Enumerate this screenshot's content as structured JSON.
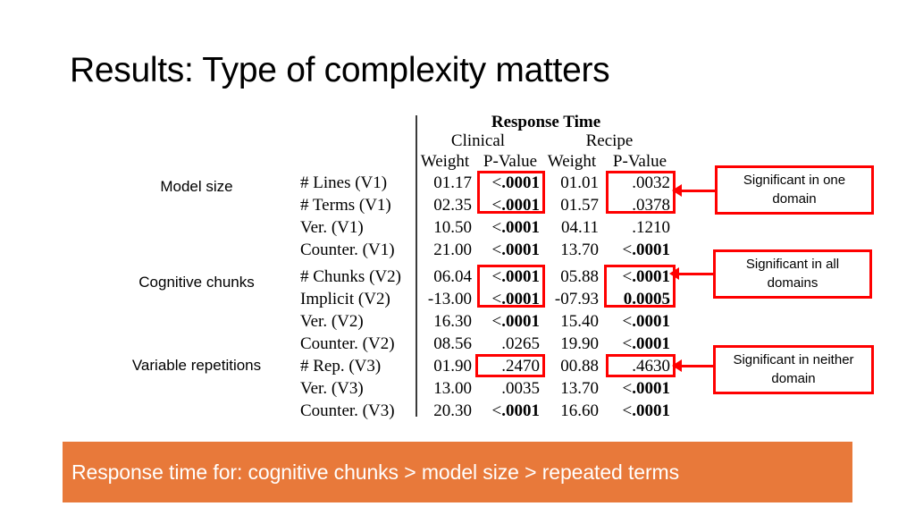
{
  "slide": {
    "title": "Results: Type of complexity matters"
  },
  "categories": [
    {
      "label": "Model size"
    },
    {
      "label": "Cognitive chunks"
    },
    {
      "label": "Variable repetitions"
    }
  ],
  "table": {
    "super_header": "Response Time",
    "group_headers": {
      "clinical": "Clinical",
      "recipe": "Recipe"
    },
    "column_headers": {
      "clinical_weight": "Weight",
      "clinical_pvalue": "P-Value",
      "recipe_weight": "Weight",
      "recipe_pvalue": "P-Value"
    },
    "groups": [
      {
        "name": "Model size",
        "rows": [
          {
            "label": "# Lines (V1)",
            "clinical_weight": "01.17",
            "clinical_p_prefix": "<",
            "clinical_p_value": ".0001",
            "clinical_p_bold": true,
            "recipe_weight": "01.01",
            "recipe_p_prefix": "",
            "recipe_p_value": ".0032",
            "recipe_p_bold": false
          },
          {
            "label": "# Terms (V1)",
            "clinical_weight": "02.35",
            "clinical_p_prefix": "<",
            "clinical_p_value": ".0001",
            "clinical_p_bold": true,
            "recipe_weight": "01.57",
            "recipe_p_prefix": "",
            "recipe_p_value": ".0378",
            "recipe_p_bold": false
          },
          {
            "label": "Ver. (V1)",
            "clinical_weight": "10.50",
            "clinical_p_prefix": "<",
            "clinical_p_value": ".0001",
            "clinical_p_bold": true,
            "recipe_weight": "04.11",
            "recipe_p_prefix": "",
            "recipe_p_value": ".1210",
            "recipe_p_bold": false
          },
          {
            "label": "Counter. (V1)",
            "clinical_weight": "21.00",
            "clinical_p_prefix": "<",
            "clinical_p_value": ".0001",
            "clinical_p_bold": true,
            "recipe_weight": "13.70",
            "recipe_p_prefix": "<",
            "recipe_p_value": ".0001",
            "recipe_p_bold": true
          }
        ]
      },
      {
        "name": "Cognitive chunks",
        "rows": [
          {
            "label": "# Chunks (V2)",
            "clinical_weight": "06.04",
            "clinical_p_prefix": "<",
            "clinical_p_value": ".0001",
            "clinical_p_bold": true,
            "recipe_weight": "05.88",
            "recipe_p_prefix": "<",
            "recipe_p_value": ".0001",
            "recipe_p_bold": true
          },
          {
            "label": "Implicit (V2)",
            "clinical_weight": "-13.00",
            "clinical_p_prefix": "<",
            "clinical_p_value": ".0001",
            "clinical_p_bold": true,
            "recipe_weight": "-07.93",
            "recipe_p_prefix": "",
            "recipe_p_value": "0.0005",
            "recipe_p_bold": true
          },
          {
            "label": "Ver. (V2)",
            "clinical_weight": "16.30",
            "clinical_p_prefix": "<",
            "clinical_p_value": ".0001",
            "clinical_p_bold": true,
            "recipe_weight": "15.40",
            "recipe_p_prefix": "<",
            "recipe_p_value": ".0001",
            "recipe_p_bold": true
          },
          {
            "label": "Counter. (V2)",
            "clinical_weight": "08.56",
            "clinical_p_prefix": "",
            "clinical_p_value": ".0265",
            "clinical_p_bold": false,
            "recipe_weight": "19.90",
            "recipe_p_prefix": "<",
            "recipe_p_value": ".0001",
            "recipe_p_bold": true
          }
        ]
      },
      {
        "name": "Variable repetitions",
        "rows": [
          {
            "label": "# Rep. (V3)",
            "clinical_weight": "01.90",
            "clinical_p_prefix": "",
            "clinical_p_value": ".2470",
            "clinical_p_bold": false,
            "recipe_weight": "00.88",
            "recipe_p_prefix": "",
            "recipe_p_value": ".4630",
            "recipe_p_bold": false
          },
          {
            "label": "Ver. (V3)",
            "clinical_weight": "13.00",
            "clinical_p_prefix": "",
            "clinical_p_value": ".0035",
            "clinical_p_bold": false,
            "recipe_weight": "13.70",
            "recipe_p_prefix": "<",
            "recipe_p_value": ".0001",
            "recipe_p_bold": true
          },
          {
            "label": "Counter. (V3)",
            "clinical_weight": "20.30",
            "clinical_p_prefix": "<",
            "clinical_p_value": ".0001",
            "clinical_p_bold": true,
            "recipe_weight": "16.60",
            "recipe_p_prefix": "<",
            "recipe_p_value": ".0001",
            "recipe_p_bold": true
          }
        ]
      }
    ]
  },
  "callouts": [
    {
      "text": "Significant in one domain"
    },
    {
      "text": "Significant in all domains"
    },
    {
      "text": "Significant in neither domain"
    }
  ],
  "footer": {
    "text": "Response time for: cognitive chunks > model size > repeated terms"
  },
  "colors": {
    "highlight": "#FF0000",
    "banner": "#E8793A",
    "banner_text": "#FFFFFF",
    "text": "#000000"
  }
}
